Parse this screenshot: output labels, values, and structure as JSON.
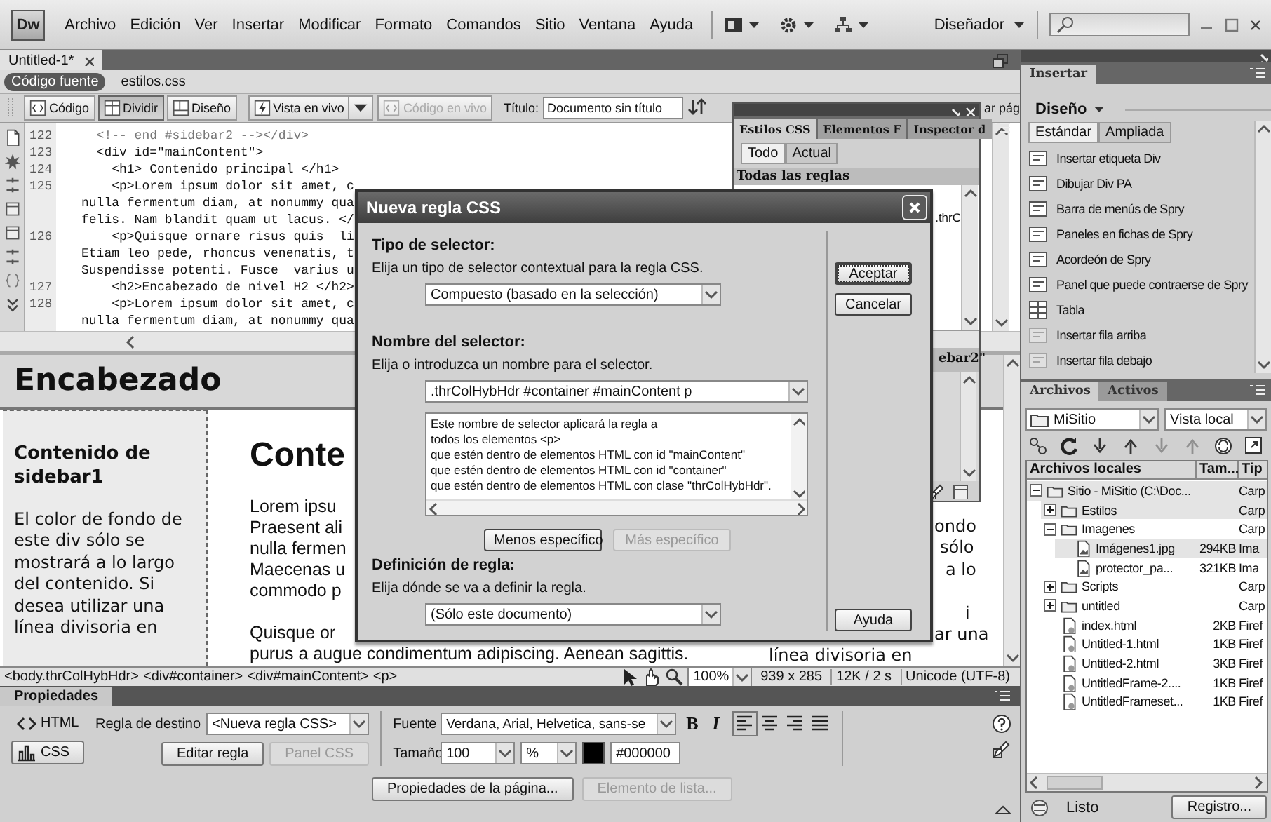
{
  "menu_bar": {
    "logo": "Dw",
    "items": [
      "Archivo",
      "Edición",
      "Ver",
      "Insertar",
      "Modificar",
      "Formato",
      "Comandos",
      "Sitio",
      "Ventana",
      "Ayuda"
    ],
    "workspace": "Diseñador"
  },
  "document": {
    "tabs": [
      {
        "label": "Untitled-1*",
        "selected": true
      }
    ],
    "related_files": [
      {
        "label": "Código fuente",
        "selected": true
      },
      {
        "label": "estilos.css",
        "selected": false
      }
    ],
    "views": [
      {
        "label": "Código",
        "selected": false
      },
      {
        "label": "Dividir",
        "selected": true
      },
      {
        "label": "Diseño",
        "selected": false
      }
    ],
    "live_view": "Vista en vivo",
    "live_code": {
      "label": "Código en vivo",
      "disabled": true
    },
    "title_label": "Título:",
    "title_value": "Documento sin título",
    "refresh_label": "ar pág"
  },
  "code": {
    "lines": [
      {
        "number": "122",
        "text": "  <!-- end #sidebar2 --></div>",
        "kind": "comment"
      },
      {
        "number": "123",
        "text": "  <div id=\"mainContent\">",
        "kind": "markup"
      },
      {
        "number": "124",
        "text": "    <h1> Contenido principal </h1>",
        "kind": "markup"
      },
      {
        "number": "125",
        "text": "    <p>Lorem ipsum dolor sit amet, c",
        "kind": "markup"
      },
      {
        "text": "nulla fermentum diam, at nonummy qua",
        "kind": "markup"
      },
      {
        "text": "felis. Nam blandit quam ut lacus. </",
        "kind": "markup"
      },
      {
        "number": "126",
        "text": "    <p>Quisque ornare risus quis  li",
        "kind": "markup"
      },
      {
        "text": "Etiam leo pede, rhoncus venenatis, t",
        "kind": "markup"
      },
      {
        "text": "Suspendisse potenti. Fusce  varius u",
        "kind": "markup"
      },
      {
        "number": "127",
        "text": "    <h2>Encabezado de nivel H2 </h2>",
        "kind": "markup"
      },
      {
        "number": "128",
        "text": "    <p>Lorem ipsum dolor sit amet, c",
        "kind": "markup"
      },
      {
        "text": "nulla fermentum diam, at nonummy qua",
        "kind": "markup"
      }
    ]
  },
  "design": {
    "header": "Encabezado",
    "sidebar1": {
      "heading": "Contenido de sidebar1",
      "text": "El color de fondo de este div sólo se mostrará a lo largo del contenido. Si desea utilizar una línea divisoria en"
    },
    "main": {
      "heading": "Conte",
      "lines": [
        {
          "text": "Lorem ipsu",
          "after_hidden_line": false
        },
        {
          "text": "Praesent ali",
          "after_hidden_line": false
        },
        {
          "text": "nulla fermen",
          "after_hidden_line": false
        },
        {
          "text": "Maecenas u",
          "after_hidden_line": false
        },
        {
          "text": "commodo p",
          "after_hidden_line": false
        },
        {
          "text": "Quisque or",
          "after_hidden_line": true
        }
      ],
      "last_line": "purus a augue condimentum adipiscing. Aenean sagittis."
    },
    "sidebar2": {
      "lines": [
        "ondo",
        "sólo",
        "a lo",
        "i",
        "ar una"
      ],
      "last_line": "línea divisoria en"
    }
  },
  "tag_selector": {
    "tags": [
      "<body.thrColHybHdr>",
      "<div#container>",
      "<div#mainContent>",
      "<p>"
    ],
    "zoom": "100%",
    "size": "939 x 285",
    "download": "12K / 2 s",
    "encoding": "Unicode (UTF-8)"
  },
  "properties": {
    "title": "Propiedades",
    "modes": [
      {
        "label": "HTML",
        "selected": false
      },
      {
        "label": "CSS",
        "selected": true
      }
    ],
    "target_rule_label": "Regla de destino",
    "target_rule": "<Nueva regla CSS>",
    "edit_rule": "Editar regla",
    "css_panel": {
      "label": "Panel CSS",
      "disabled": true
    },
    "font_label": "Fuente",
    "font": "Verdana, Arial, Helvetica, sans-se",
    "format_buttons": [
      "B",
      "I"
    ],
    "size_label": "Tamaño",
    "size": "100",
    "unit": "%",
    "color": "#000000",
    "page_properties": "Propiedades de la página...",
    "list_item": {
      "label": "Elemento de lista...",
      "disabled": true
    }
  },
  "css_styles_panel": {
    "tabs": [
      {
        "label": "Estilos CSS",
        "selected": true
      },
      {
        "label": "Elementos F",
        "selected": false
      },
      {
        "label": "Inspector d",
        "selected": false
      }
    ],
    "modes": [
      {
        "label": "Todo",
        "selected": true
      },
      {
        "label": "Actual",
        "selected": false
      }
    ],
    "section": "Todas las reglas",
    "rule": ".thrC",
    "properties_header": "ebar2\""
  },
  "dialog": {
    "title": "Nueva regla CSS",
    "selector_type": {
      "heading": "Tipo de selector:",
      "hint": "Elija un tipo de selector contextual para la regla CSS.",
      "value": "Compuesto (basado en la selección)"
    },
    "selector_name": {
      "heading": "Nombre del selector:",
      "hint": "Elija o introduzca un nombre para el selector.",
      "value": ".thrColHybHdr #container #mainContent p",
      "description": [
        "Este nombre de selector aplicará la regla a",
        "todos los elementos <p>",
        "que estén dentro de elementos HTML con id \"mainContent\"",
        "que estén dentro de elementos HTML con id \"container\"",
        "que estén dentro de elementos HTML con clase \"thrColHybHdr\"."
      ],
      "less_specific": {
        "label": "Menos específico",
        "disabled": false
      },
      "more_specific": {
        "label": "Más específico",
        "disabled": true
      }
    },
    "rule_definition": {
      "heading": "Definición de regla:",
      "hint": "Elija dónde se va a definir la regla.",
      "value": "(Sólo este documento)"
    },
    "buttons": [
      {
        "label": "Aceptar",
        "default": true
      },
      {
        "label": "Cancelar",
        "default": false
      },
      {
        "label": "Ayuda",
        "default": false
      }
    ]
  },
  "insert_panel": {
    "title": "Insertar",
    "category": "Diseño",
    "tabs": [
      {
        "label": "Estándar",
        "selected": true
      },
      {
        "label": "Ampliada",
        "selected": false
      }
    ],
    "items": [
      {
        "label": "Insertar etiqueta Div",
        "disabled": false
      },
      {
        "label": "Dibujar Div PA",
        "disabled": false
      },
      {
        "label": "Barra de menús de Spry",
        "disabled": false
      },
      {
        "label": "Paneles en fichas de Spry",
        "disabled": false
      },
      {
        "label": "Acordeón de Spry",
        "disabled": false
      },
      {
        "label": "Panel que puede contraerse de Spry",
        "disabled": false
      },
      {
        "label": "Tabla",
        "disabled": false
      },
      {
        "label": "Insertar fila arriba",
        "disabled": true
      },
      {
        "label": "Insertar fila debajo",
        "disabled": true
      }
    ]
  },
  "files_panel": {
    "tabs": [
      {
        "label": "Archivos",
        "selected": true
      },
      {
        "label": "Activos",
        "selected": false
      }
    ],
    "site": "MiSitio",
    "view": "Vista local",
    "columns": [
      "Archivos locales",
      "Tam...",
      "Tip"
    ],
    "tree": [
      {
        "name": "Sitio - MiSitio (C:\\Doc...",
        "type": "Carp",
        "kind": "folder",
        "expanded": true,
        "children": [
          {
            "name": "Estilos",
            "type": "Carp",
            "kind": "folder",
            "expanded": false
          },
          {
            "name": "Imagenes",
            "type": "Carp",
            "kind": "folder",
            "expanded": true,
            "children": [
              {
                "name": "Imágenes1.jpg",
                "size": "294KB",
                "type": "Ima",
                "kind": "image"
              },
              {
                "name": "protector_pa...",
                "size": "321KB",
                "type": "Ima",
                "kind": "image"
              }
            ]
          },
          {
            "name": "Scripts",
            "type": "Carp",
            "kind": "folder",
            "expanded": false
          },
          {
            "name": "untitled",
            "type": "Carp",
            "kind": "folder",
            "expanded": false
          },
          {
            "name": "index.html",
            "size": "2KB",
            "type": "Firef",
            "kind": "html"
          },
          {
            "name": "Untitled-1.html",
            "size": "1KB",
            "type": "Firef",
            "kind": "html"
          },
          {
            "name": "Untitled-2.html",
            "size": "3KB",
            "type": "Firef",
            "kind": "html"
          },
          {
            "name": "UntitledFrame-2....",
            "size": "1KB",
            "type": "Firef",
            "kind": "html"
          },
          {
            "name": "UntitledFrameset...",
            "size": "1KB",
            "type": "Firef",
            "kind": "html"
          }
        ]
      }
    ],
    "status": "Listo",
    "log_button": "Registro..."
  }
}
